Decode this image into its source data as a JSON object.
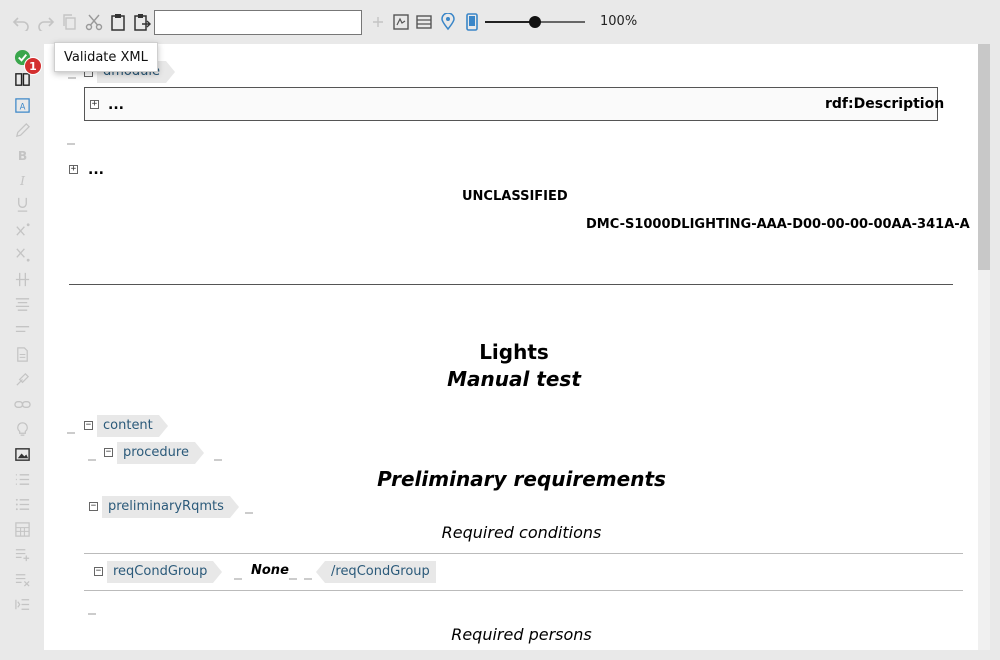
{
  "toolbar": {
    "search_value": "",
    "zoom_label": "100%",
    "zoom_percent": 50
  },
  "tooltip": {
    "text": "Validate XML"
  },
  "validation": {
    "error_count": "1"
  },
  "document": {
    "dmodule_tag": "dmodule",
    "description_ellipsis": "...",
    "description_label": "rdf:Description",
    "ident_ellipsis": "...",
    "classification": "UNCLASSIFIED",
    "dmc": "DMC-S1000DLIGHTING-AAA-D00-00-00-00AA-341A-A",
    "title": "Lights",
    "subtitle": "Manual test",
    "content_tag": "content",
    "procedure_tag": "procedure",
    "prelim_heading": "Preliminary requirements",
    "prelim_tag": "preliminaryRqmts",
    "req_conditions": "Required conditions",
    "req_cond_tag": "reqCondGroup",
    "req_cond_none": "None",
    "req_cond_close_tag": "/reqCondGroup",
    "req_persons": "Required persons"
  }
}
